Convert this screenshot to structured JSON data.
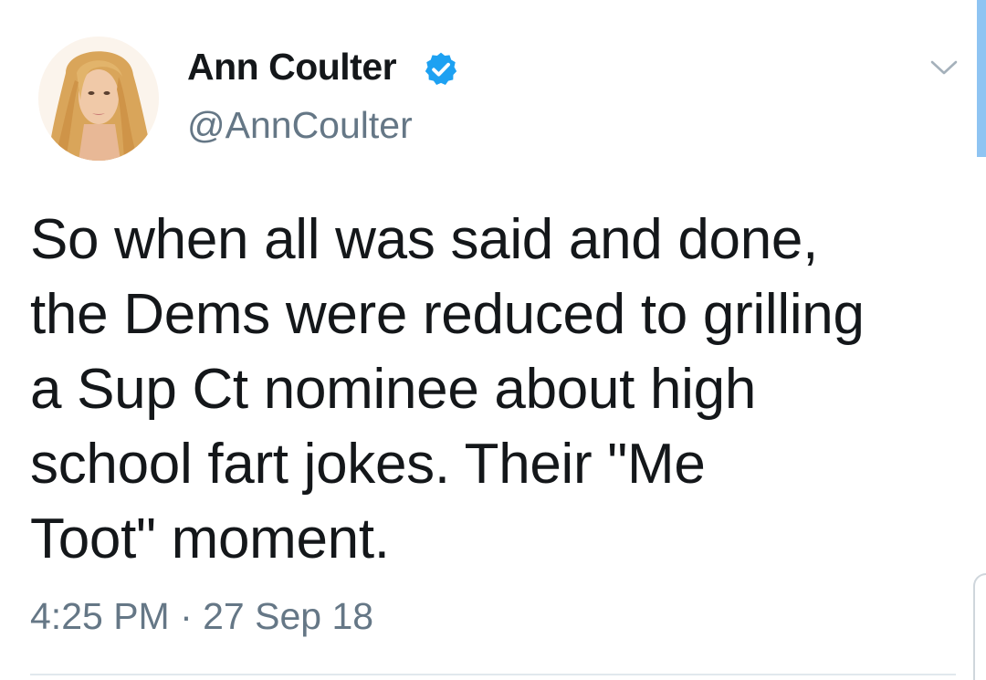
{
  "author": {
    "name": "Ann Coulter",
    "handle": "@AnnCoulter",
    "verified": true,
    "verified_color": "#1da1f2"
  },
  "tweet": {
    "text": "So when all was said and done,\nthe Dems were reduced to grilling\na Sup Ct nominee about high\nschool fart jokes. Their \"Me\nToot\" moment.",
    "timestamp": "4:25 PM · 27 Sep 18"
  },
  "icons": {
    "verified": "verified-badge-icon",
    "menu": "chevron-down-icon"
  },
  "colors": {
    "text": "#14171a",
    "secondary_text": "#657786",
    "divider": "#e1e8ed",
    "accent": "#1da1f2"
  }
}
